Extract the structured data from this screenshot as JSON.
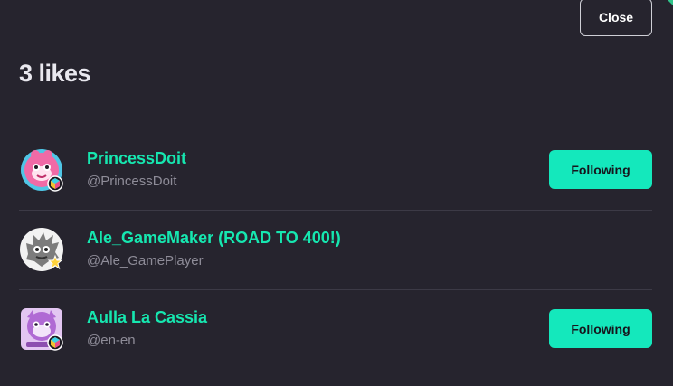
{
  "dialog": {
    "close_label": "Close",
    "title": "3 likes"
  },
  "likes": [
    {
      "name": "PrincessDoit",
      "handle": "@PrincessDoit",
      "button_label": "Following",
      "avatar_icon": "pink-character-avatar",
      "badge_icon": "multicolor-cube-badge-icon"
    },
    {
      "name": "Ale_GameMaker (ROAD TO 400!)",
      "handle": "@Ale_GamePlayer",
      "button_label": "",
      "avatar_icon": "grey-spiky-character-avatar",
      "badge_icon": "star-badge-icon"
    },
    {
      "name": "Aulla La Cassia",
      "handle": "@en-en",
      "button_label": "Following",
      "avatar_icon": "purple-character-avatar",
      "badge_icon": "multicolor-cube-badge-icon"
    }
  ],
  "colors": {
    "background": "#26242e",
    "accent": "#14e8bc",
    "name_text": "#16e7b0",
    "handle_text": "#8e8c98",
    "divider": "#3c3a46"
  }
}
